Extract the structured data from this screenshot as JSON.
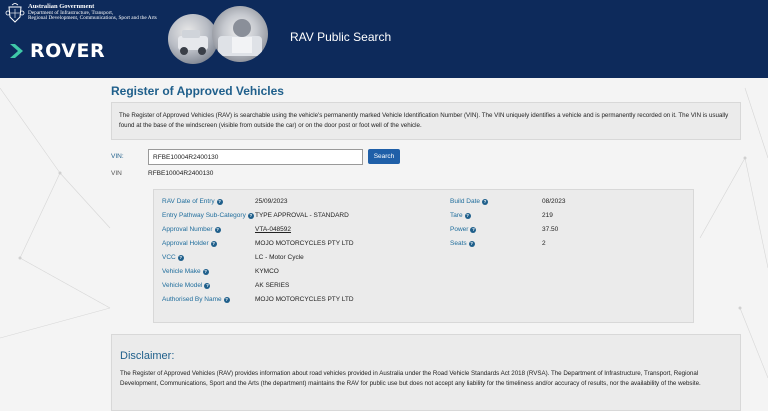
{
  "header": {
    "gov_line1": "Australian Government",
    "gov_line2": "Department of Infrastructure, Transport,",
    "gov_line3": "Regional Development, Communications, Sport and the Arts",
    "brand": "ROVER",
    "title": "RAV Public Search"
  },
  "page": {
    "title": "Register of Approved Vehicles",
    "intro": "The Register of Approved Vehicles (RAV) is searchable using the vehicle's permanently marked Vehicle Identification Number (VIN). The VIN uniquely identifies a vehicle and is permanently recorded on it. The VIN is usually found at the base of the windscreen (visible from outside the car) or on the door post or foot well of the vehicle."
  },
  "search": {
    "label": "VIN:",
    "value": "RFBE10004R2400130",
    "button": "Search"
  },
  "result": {
    "vin_label": "VIN",
    "vin_value": "RFBE10004R2400130"
  },
  "details": {
    "left": [
      {
        "label": "RAV Date of Entry",
        "value": "25/09/2023"
      },
      {
        "label": "Entry Pathway Sub-Category",
        "value": "TYPE APPROVAL - STANDARD"
      },
      {
        "label": "Approval Number",
        "value": "VTA-048592"
      },
      {
        "label": "Approval Holder",
        "value": "MOJO MOTORCYCLES PTY LTD"
      },
      {
        "label": "VCC",
        "value": "LC - Motor Cycle"
      },
      {
        "label": "Vehicle Make",
        "value": "KYMCO"
      },
      {
        "label": "Vehicle Model",
        "value": "AK SERIES"
      },
      {
        "label": "Authorised By Name",
        "value": "MOJO MOTORCYCLES PTY LTD"
      }
    ],
    "right": [
      {
        "label": "Build Date",
        "value": "08/2023"
      },
      {
        "label": "Tare",
        "value": "219"
      },
      {
        "label": "Power",
        "value": "37.50"
      },
      {
        "label": "Seats",
        "value": "2"
      }
    ]
  },
  "disclaimer": {
    "title": "Disclaimer:",
    "text": "The Register of Approved Vehicles (RAV) provides information about road vehicles provided in Australia under the Road Vehicle Standards Act 2018 (RVSA). The Department of Infrastructure, Transport, Regional Development, Communications, Sport and the Arts (the department) maintains the RAV for public use but does not accept any liability for the timeliness and/or accuracy of results, nor the availability of the website."
  },
  "colors": {
    "header_bg": "#0d2a5b",
    "title_blue": "#1f5f8b",
    "button_blue": "#1f5fa8",
    "accent_green": "#3fc8a8"
  },
  "icons": {
    "crest": "coat-of-arms-icon",
    "brand_mark": "chevron-right-icon",
    "help": "info-circle-icon"
  }
}
